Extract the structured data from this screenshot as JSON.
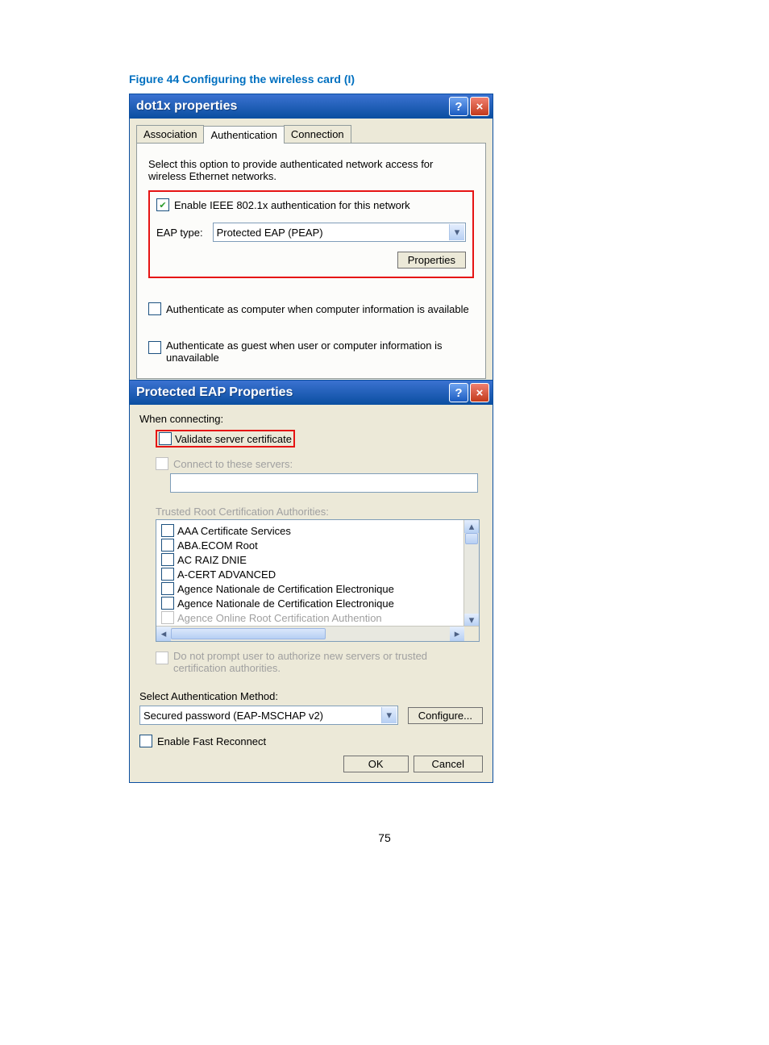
{
  "caption": "Figure 44 Configuring the wireless card (I)",
  "win1": {
    "title": "dot1x properties",
    "tabs": {
      "t1": "Association",
      "t2": "Authentication",
      "t3": "Connection"
    },
    "desc": "Select this option to provide authenticated network access for wireless Ethernet networks.",
    "chk_enable": "Enable IEEE 802.1x authentication for this network",
    "eap_label": "EAP type:",
    "eap_value": "Protected EAP (PEAP)",
    "btn_props": "Properties",
    "chk_comp": "Authenticate as computer when computer information is available",
    "chk_guest": "Authenticate as guest when user or computer information is unavailable"
  },
  "win2": {
    "title": "Protected EAP Properties",
    "when": "When connecting:",
    "chk_validate": "Validate server certificate",
    "chk_connect": "Connect to these servers:",
    "trusted": "Trusted Root Certification Authorities:",
    "cas": {
      "c0": "AAA Certificate Services",
      "c1": "ABA.ECOM Root",
      "c2": "AC RAIZ DNIE",
      "c3": "A-CERT ADVANCED",
      "c4": "Agence Nationale de Certification Electronique",
      "c5": "Agence Nationale de Certification Electronique",
      "c6": "Agence Online Root Certification Authention"
    },
    "chk_noprompt": "Do not prompt user to authorize new servers or trusted certification authorities.",
    "sel_auth": "Select Authentication Method:",
    "auth_value": "Secured password (EAP-MSCHAP v2)",
    "btn_configure": "Configure...",
    "chk_fast": "Enable Fast Reconnect",
    "btn_ok": "OK",
    "btn_cancel": "Cancel"
  },
  "pagenum": "75"
}
